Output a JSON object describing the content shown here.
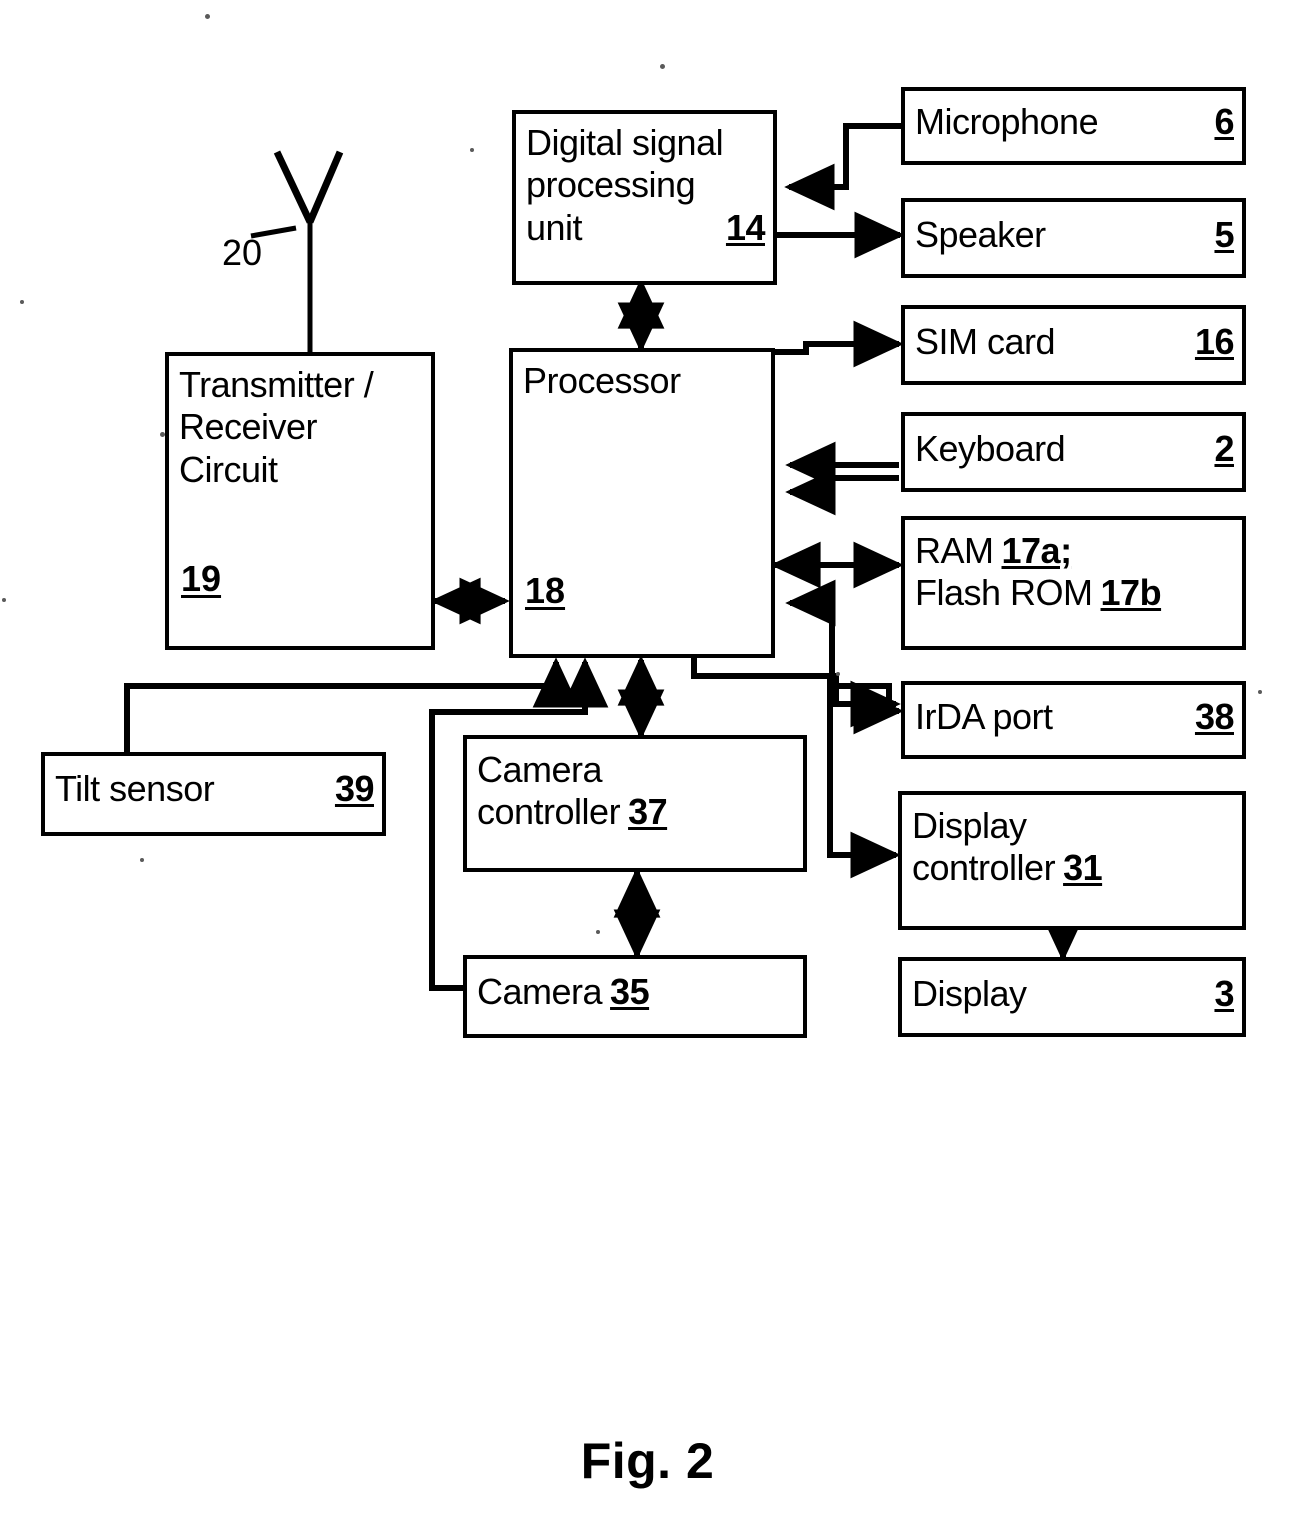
{
  "figure": {
    "caption": "Fig. 2",
    "antenna_label": "20"
  },
  "blocks": {
    "dsp": {
      "line1": "Digital signal",
      "line2": "processing",
      "line3": "unit",
      "ref": "14"
    },
    "microphone": {
      "label": "Microphone",
      "ref": "6"
    },
    "speaker": {
      "label": "Speaker",
      "ref": "5"
    },
    "sim_card": {
      "label": "SIM card",
      "ref": "16"
    },
    "keyboard": {
      "label": "Keyboard",
      "ref": "2"
    },
    "memory": {
      "line1_label": "RAM",
      "line1_ref": "17a;",
      "line2_label": "Flash ROM",
      "line2_ref": "17b"
    },
    "irda": {
      "label": "IrDA port",
      "ref": "38"
    },
    "display_controller": {
      "line1": "Display",
      "line2": "controller",
      "ref": "31"
    },
    "display": {
      "label": "Display",
      "ref": "3"
    },
    "transceiver": {
      "line1": "Transmitter /",
      "line2": "Receiver",
      "line3": "Circuit",
      "ref": "19"
    },
    "processor": {
      "label": "Processor",
      "ref": "18"
    },
    "tilt_sensor": {
      "label": "Tilt sensor",
      "ref": "39"
    },
    "camera_controller": {
      "line1": "Camera",
      "line2": "controller",
      "ref": "37"
    },
    "camera": {
      "label": "Camera",
      "ref": "35"
    }
  },
  "connections": [
    {
      "name": "microphone-to-dsp",
      "from": "microphone",
      "to": "dsp",
      "direction": "one-way"
    },
    {
      "name": "dsp-to-speaker",
      "from": "dsp",
      "to": "speaker",
      "direction": "one-way"
    },
    {
      "name": "dsp-processor",
      "from": "dsp",
      "to": "processor",
      "direction": "two-way"
    },
    {
      "name": "processor-to-sim",
      "from": "processor",
      "to": "sim_card",
      "direction": "one-way"
    },
    {
      "name": "keyboard-to-processor",
      "from": "keyboard",
      "to": "processor",
      "direction": "one-way"
    },
    {
      "name": "processor-memory",
      "from": "processor",
      "to": "memory",
      "direction": "two-way"
    },
    {
      "name": "processor-to-irda",
      "from": "processor",
      "to": "irda",
      "direction": "one-way"
    },
    {
      "name": "processor-to-display-controller",
      "from": "processor",
      "to": "display_controller",
      "direction": "one-way"
    },
    {
      "name": "display-controller-to-display",
      "from": "display_controller",
      "to": "display",
      "direction": "one-way"
    },
    {
      "name": "transceiver-processor",
      "from": "transceiver",
      "to": "processor",
      "direction": "two-way"
    },
    {
      "name": "antenna-to-transceiver",
      "from": "antenna",
      "to": "transceiver",
      "direction": "line"
    },
    {
      "name": "tilt-sensor-to-processor",
      "from": "tilt_sensor",
      "to": "processor",
      "direction": "one-way"
    },
    {
      "name": "camera-to-processor",
      "from": "camera",
      "to": "processor",
      "direction": "one-way"
    },
    {
      "name": "processor-camera-controller",
      "from": "processor",
      "to": "camera_controller",
      "direction": "two-way"
    },
    {
      "name": "camera-controller-camera",
      "from": "camera_controller",
      "to": "camera",
      "direction": "two-way"
    }
  ]
}
